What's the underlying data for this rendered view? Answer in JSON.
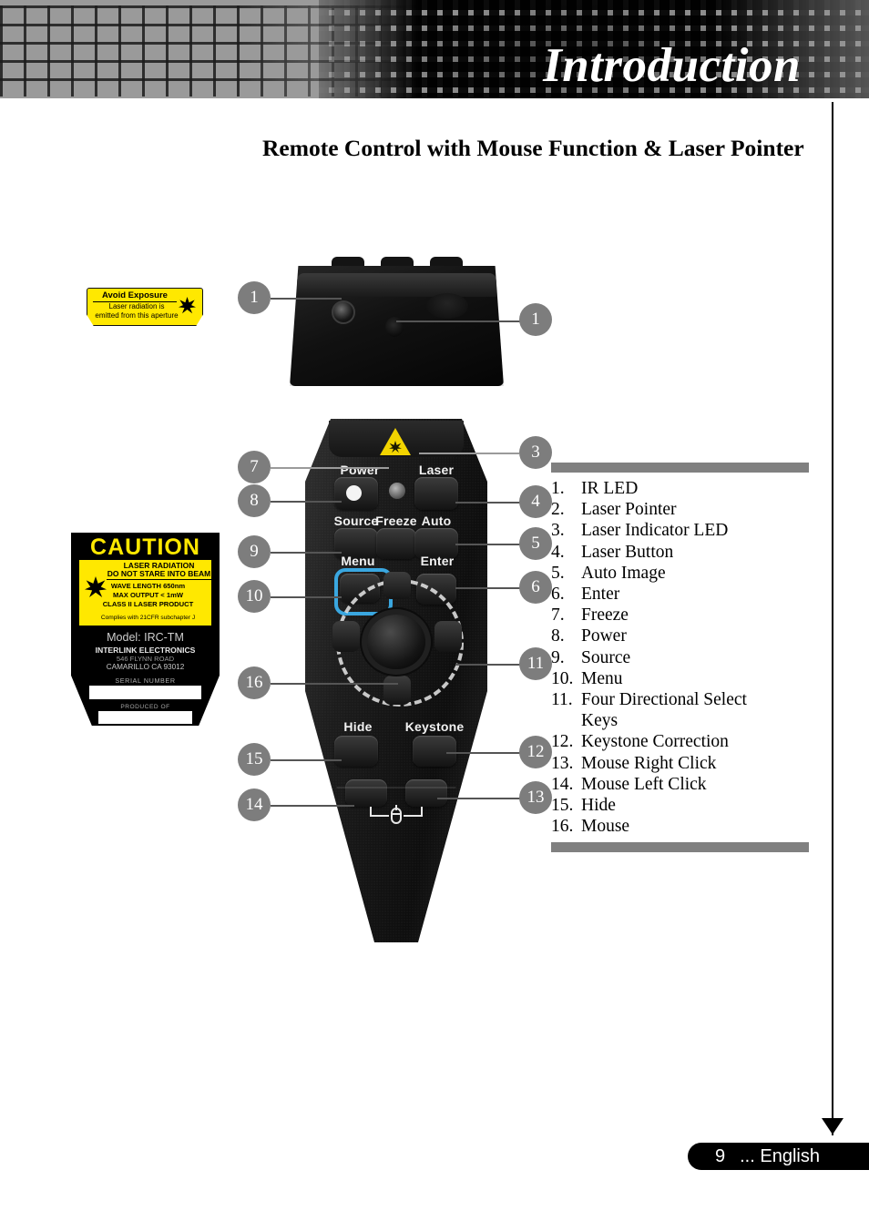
{
  "header": {
    "title": "Introduction"
  },
  "section": {
    "title": "Remote Control with Mouse Function & Laser Pointer"
  },
  "legend": {
    "items": [
      {
        "num": "1.",
        "label": "IR LED"
      },
      {
        "num": "2.",
        "label": "Laser Pointer"
      },
      {
        "num": "3.",
        "label": "Laser Indicator LED"
      },
      {
        "num": "4.",
        "label": "Laser Button"
      },
      {
        "num": "5.",
        "label": "Auto Image"
      },
      {
        "num": "6.",
        "label": "Enter"
      },
      {
        "num": "7.",
        "label": "Freeze"
      },
      {
        "num": "8.",
        "label": "Power"
      },
      {
        "num": "9.",
        "label": "Source"
      },
      {
        "num": "10.",
        "label": "Menu"
      },
      {
        "num": "11.",
        "label": "Four Directional  Select",
        "label2": "Keys"
      },
      {
        "num": "12.",
        "label": "Keystone Correction"
      },
      {
        "num": "13.",
        "label": "Mouse Right Click"
      },
      {
        "num": "14.",
        "label": "Mouse Left Click"
      },
      {
        "num": "15.",
        "label": "Hide"
      },
      {
        "num": "16.",
        "label": "Mouse"
      }
    ]
  },
  "callouts": {
    "c1a": "1",
    "c1b": "1",
    "c3": "3",
    "c4": "4",
    "c5": "5",
    "c6": "6",
    "c7": "7",
    "c8": "8",
    "c9": "9",
    "c10": "10",
    "c11": "11",
    "c12": "12",
    "c13": "13",
    "c14": "14",
    "c15": "15",
    "c16": "16"
  },
  "remote": {
    "buttons": {
      "power": "Power",
      "laser": "Laser",
      "source": "Source",
      "freeze": "Freeze",
      "auto": "Auto",
      "menu": "Menu",
      "enter": "Enter",
      "hide": "Hide",
      "keystone": "Keystone"
    }
  },
  "avoid_label": {
    "line1": "Avoid Exposure",
    "line2": "Laser radiation is",
    "line3": "emitted from this aperture"
  },
  "caution_label": {
    "title": "CAUTION",
    "l1": "LASER RADIATION",
    "l2": "DO NOT STARE INTO BEAM",
    "l3": "WAVE LENGTH  650nm",
    "l4": "MAX OUTPUT < 1mW",
    "l5": "CLASS II LASER PRODUCT",
    "l6": "Complies with 21CFR subchapter J",
    "model": "Model: IRC-TM",
    "company": "INTERLINK ELECTRONICS",
    "address1": "546 FLYNN ROAD",
    "address2": "CAMARILLO CA 93012",
    "serial": "SERIAL NUMBER",
    "produced": "PRODUCED OF"
  },
  "footer": {
    "page": "9",
    "language": "... English"
  },
  "colors": {
    "header_band": "#9a9a9a",
    "divider_bar": "#808080",
    "callout_bubble": "#7d7d7d",
    "caution_yellow": "#ffe800",
    "menu_ring_blue": "#3aa7e0"
  }
}
